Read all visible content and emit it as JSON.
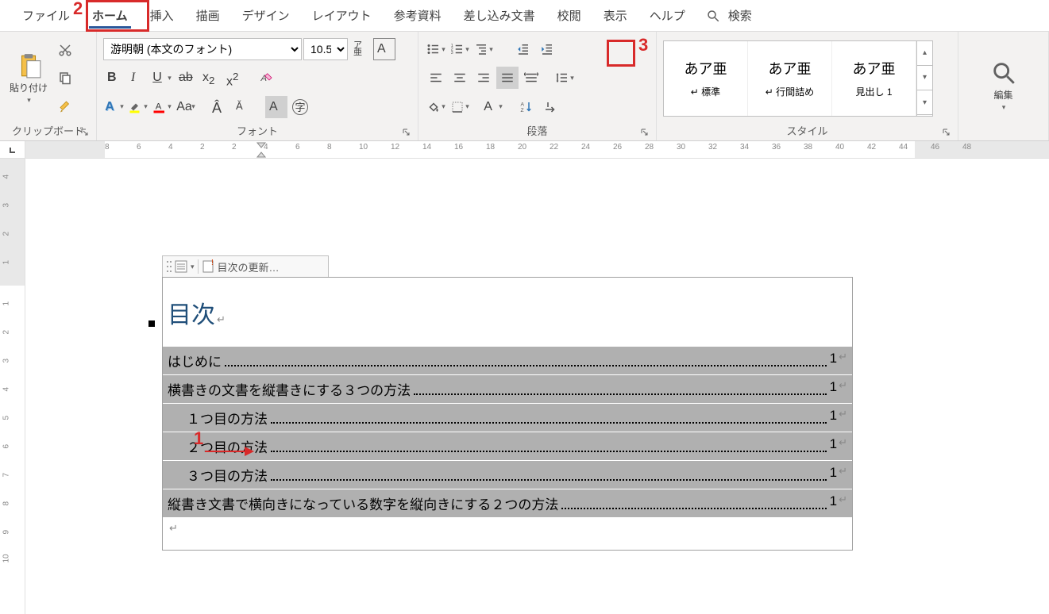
{
  "tabs": {
    "file": "ファイル",
    "home": "ホーム",
    "insert": "挿入",
    "draw": "描画",
    "design": "デザイン",
    "layout": "レイアウト",
    "references": "参考資料",
    "mailings": "差し込み文書",
    "review": "校閲",
    "view": "表示",
    "help": "ヘルプ",
    "search": "検索"
  },
  "ribbon": {
    "clipboard": {
      "label": "クリップボード",
      "paste": "貼り付け"
    },
    "font": {
      "label": "フォント",
      "name": "游明朝 (本文のフォント)",
      "size": "10.5",
      "ruby": "ア\n亜"
    },
    "paragraph": {
      "label": "段落"
    },
    "styles": {
      "label": "スタイル",
      "items": [
        {
          "preview": "あア亜",
          "name": "↵ 標準"
        },
        {
          "preview": "あア亜",
          "name": "↵ 行間詰め"
        },
        {
          "preview": "あア亜",
          "name": "見出し 1"
        }
      ]
    },
    "editing": {
      "label": "編集"
    }
  },
  "toc_toolbar": {
    "update": "目次の更新…"
  },
  "document": {
    "toc_title": "目次",
    "return_mark": "↵",
    "entries": [
      {
        "label": "はじめに",
        "page": "1",
        "indent": 0
      },
      {
        "label": "横書きの文書を縦書きにする３つの方法",
        "page": "1",
        "indent": 0
      },
      {
        "label": "１つ目の方法",
        "page": "1",
        "indent": 1
      },
      {
        "label": "２つ目の方法",
        "page": "1",
        "indent": 1
      },
      {
        "label": "３つ目の方法",
        "page": "1",
        "indent": 1
      },
      {
        "label": "縦書き文書で横向きになっている数字を縦向きにする２つの方法",
        "page": "1",
        "indent": 0
      }
    ]
  },
  "callouts": {
    "c1": "1",
    "c2": "2",
    "c3": "3"
  },
  "ruler": {
    "h": [
      "8",
      "6",
      "4",
      "2",
      "2",
      "4",
      "6",
      "8",
      "10",
      "12",
      "14",
      "16",
      "18",
      "20",
      "22",
      "24",
      "26",
      "28",
      "30",
      "32",
      "34",
      "36",
      "38",
      "40",
      "42",
      "44",
      "46",
      "48"
    ],
    "v_top": [
      "4",
      "3",
      "2",
      "1"
    ],
    "v_main": [
      "1",
      "2",
      "3",
      "4",
      "5",
      "6",
      "7",
      "8",
      "9",
      "10"
    ]
  }
}
